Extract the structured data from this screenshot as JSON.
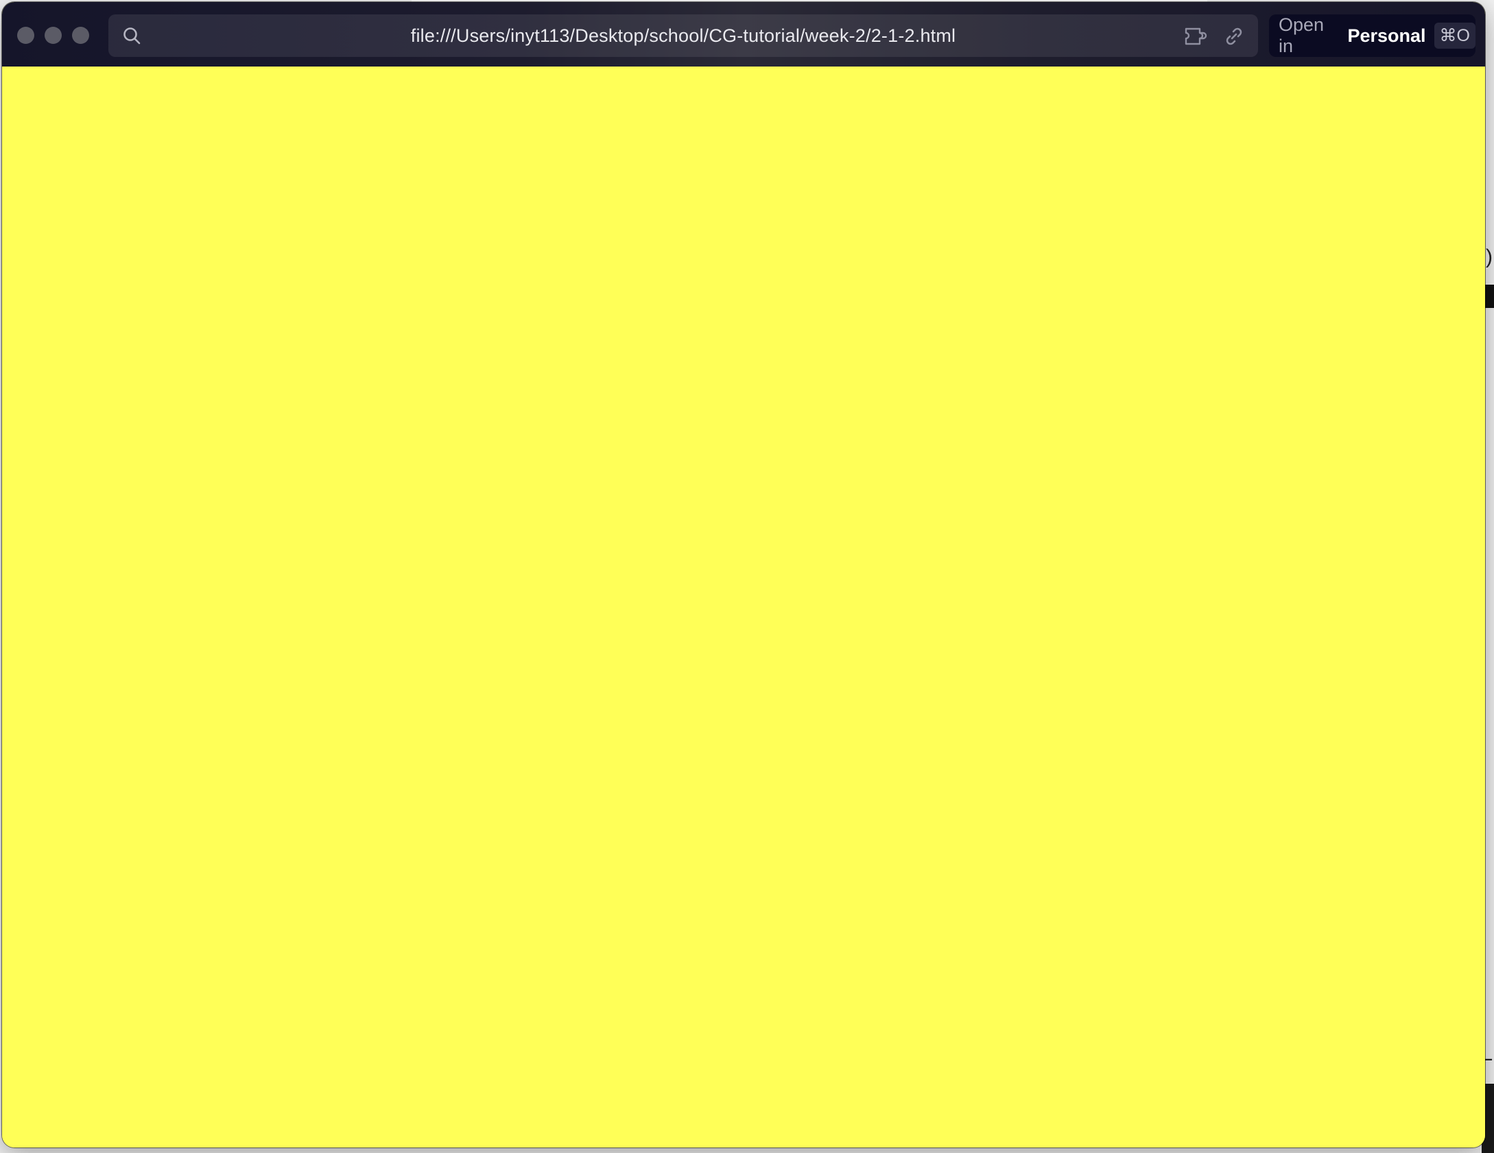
{
  "browser": {
    "url": "file:///Users/inyt113/Desktop/school/CG-tutorial/week-2/2-1-2.html",
    "open_in": {
      "label": "Open in",
      "profile": "Personal",
      "shortcut": "⌘O"
    },
    "traffic_lights": [
      "close",
      "minimize",
      "zoom"
    ]
  },
  "page": {
    "background_color": "#ffff57"
  },
  "desktop_edge": {
    "glyph_top": ")",
    "glyph_bottom": "L"
  },
  "colors": {
    "titlebar": "#1d1c2e",
    "open_in_bg": "#0b0b22",
    "traffic_light": "#5b5b66"
  },
  "icons": {
    "url_search": "search-icon",
    "extensions": "puzzle-icon",
    "copy_link": "link-icon"
  }
}
